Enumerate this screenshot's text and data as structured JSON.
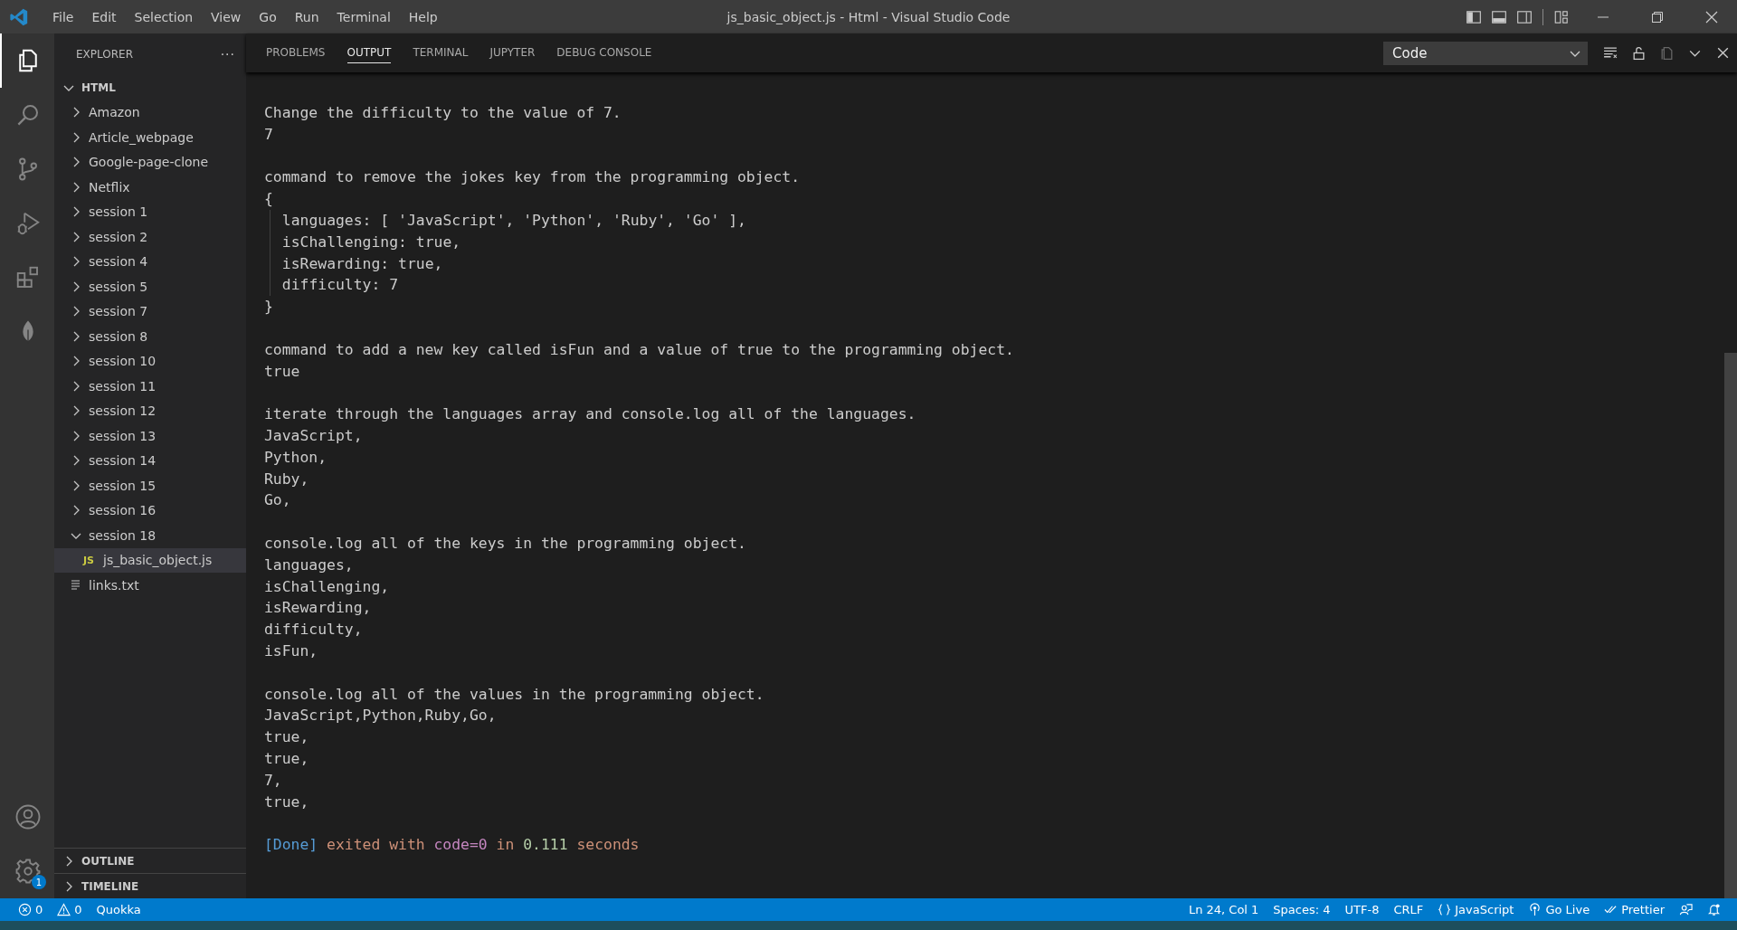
{
  "window": {
    "title": "js_basic_object.js - Html - Visual Studio Code"
  },
  "menu": [
    "File",
    "Edit",
    "Selection",
    "View",
    "Go",
    "Run",
    "Terminal",
    "Help"
  ],
  "activity_bar": {
    "top": [
      {
        "kind": "explorer",
        "selected": true
      },
      {
        "kind": "search",
        "selected": false
      },
      {
        "kind": "source-control",
        "selected": false
      },
      {
        "kind": "run-debug",
        "selected": false
      },
      {
        "kind": "extensions",
        "selected": false
      },
      {
        "kind": "leaf",
        "selected": false
      }
    ],
    "bottom": [
      {
        "kind": "account"
      },
      {
        "kind": "settings",
        "badge": "1"
      }
    ]
  },
  "sidebar": {
    "title": "EXPLORER",
    "more": "···",
    "tree": [
      {
        "label": "HTML",
        "kind": "root",
        "expanded": true,
        "selected": false,
        "children": [
          {
            "label": "Amazon",
            "kind": "folder",
            "expanded": false,
            "selected": false
          },
          {
            "label": "Article_webpage",
            "kind": "folder",
            "expanded": false,
            "selected": false
          },
          {
            "label": "Google-page-clone",
            "kind": "folder",
            "expanded": false,
            "selected": false
          },
          {
            "label": "Netflix",
            "kind": "folder",
            "expanded": false,
            "selected": false
          },
          {
            "label": "session 1",
            "kind": "folder",
            "expanded": false,
            "selected": false
          },
          {
            "label": "session 2",
            "kind": "folder",
            "expanded": false,
            "selected": false
          },
          {
            "label": "session 4",
            "kind": "folder",
            "expanded": false,
            "selected": false
          },
          {
            "label": "session 5",
            "kind": "folder",
            "expanded": false,
            "selected": false
          },
          {
            "label": "session 7",
            "kind": "folder",
            "expanded": false,
            "selected": false
          },
          {
            "label": "session 8",
            "kind": "folder",
            "expanded": false,
            "selected": false
          },
          {
            "label": "session 10",
            "kind": "folder",
            "expanded": false,
            "selected": false
          },
          {
            "label": "session 11",
            "kind": "folder",
            "expanded": false,
            "selected": false
          },
          {
            "label": "session 12",
            "kind": "folder",
            "expanded": false,
            "selected": false
          },
          {
            "label": "session 13",
            "kind": "folder",
            "expanded": false,
            "selected": false
          },
          {
            "label": "session 14",
            "kind": "folder",
            "expanded": false,
            "selected": false
          },
          {
            "label": "session 15",
            "kind": "folder",
            "expanded": false,
            "selected": false
          },
          {
            "label": "session 16",
            "kind": "folder",
            "expanded": false,
            "selected": false
          },
          {
            "label": "session 18",
            "kind": "folder",
            "expanded": true,
            "selected": false,
            "children": [
              {
                "label": "js_basic_object.js",
                "kind": "js-file",
                "badge": "JS",
                "selected": true
              }
            ]
          },
          {
            "label": "links.txt",
            "kind": "text-file",
            "selected": false
          }
        ]
      }
    ],
    "sections": [
      {
        "label": "OUTLINE",
        "expanded": false
      },
      {
        "label": "TIMELINE",
        "expanded": false
      }
    ]
  },
  "panel": {
    "tabs": [
      {
        "label": "PROBLEMS",
        "selected": false
      },
      {
        "label": "OUTPUT",
        "selected": true
      },
      {
        "label": "TERMINAL",
        "selected": false
      },
      {
        "label": "JUPYTER",
        "selected": false
      },
      {
        "label": "DEBUG CONSOLE",
        "selected": false
      }
    ],
    "channel": "Code",
    "output": [
      {
        "lines": [
          {
            "text": "Change the difficulty to the value of 7.",
            "indent": false
          },
          {
            "text": "7",
            "indent": false
          }
        ]
      },
      {
        "lines": [
          {
            "text": "command to remove the jokes key from the programming object.",
            "indent": false
          },
          {
            "text": "{",
            "indent": false
          },
          {
            "text": "languages: [ 'JavaScript', 'Python', 'Ruby', 'Go' ],",
            "indent": true
          },
          {
            "text": "isChallenging: true,",
            "indent": true
          },
          {
            "text": "isRewarding: true,",
            "indent": true
          },
          {
            "text": "difficulty: 7",
            "indent": true
          },
          {
            "text": "}",
            "indent": false
          }
        ]
      },
      {
        "lines": [
          {
            "text": "command to add a new key called isFun and a value of true to the programming object.",
            "indent": false
          },
          {
            "text": "true",
            "indent": false
          }
        ]
      },
      {
        "lines": [
          {
            "text": "iterate through the languages array and console.log all of the languages.",
            "indent": false
          },
          {
            "text": "JavaScript,",
            "indent": false
          },
          {
            "text": "Python,",
            "indent": false
          },
          {
            "text": "Ruby,",
            "indent": false
          },
          {
            "text": "Go,",
            "indent": false
          }
        ]
      },
      {
        "lines": [
          {
            "text": "console.log all of the keys in the programming object.",
            "indent": false
          },
          {
            "text": "languages,",
            "indent": false
          },
          {
            "text": "isChallenging,",
            "indent": false
          },
          {
            "text": "isRewarding,",
            "indent": false
          },
          {
            "text": "difficulty,",
            "indent": false
          },
          {
            "text": "isFun,",
            "indent": false
          }
        ]
      },
      {
        "lines": [
          {
            "text": "console.log all of the values in the programming object.",
            "indent": false
          },
          {
            "text": "JavaScript,Python,Ruby,Go,",
            "indent": false
          },
          {
            "text": "true,",
            "indent": false
          },
          {
            "text": "true,",
            "indent": false
          },
          {
            "text": "7,",
            "indent": false
          },
          {
            "text": "true,",
            "indent": false
          }
        ]
      }
    ],
    "done_line": [
      {
        "text": "[Done]",
        "kind": "tag"
      },
      {
        "text": "exited with",
        "kind": "plain"
      },
      {
        "text": "code=0",
        "kind": "code"
      },
      {
        "text": "in",
        "kind": "plain"
      },
      {
        "text": "0.111",
        "kind": "number"
      },
      {
        "text": "seconds",
        "kind": "plain"
      }
    ]
  },
  "status_bar": {
    "left": [
      {
        "kind": "errors",
        "text": "0"
      },
      {
        "kind": "warnings",
        "text": "0"
      },
      {
        "kind": "plain",
        "text": "Quokka"
      }
    ],
    "right": [
      {
        "kind": "plain",
        "text": "Ln 24, Col 1"
      },
      {
        "kind": "plain",
        "text": "Spaces: 4"
      },
      {
        "kind": "plain",
        "text": "UTF-8"
      },
      {
        "kind": "plain",
        "text": "CRLF"
      },
      {
        "kind": "language",
        "text": "JavaScript"
      },
      {
        "kind": "go-live",
        "text": "Go Live"
      },
      {
        "kind": "prettier",
        "text": "Prettier"
      },
      {
        "kind": "feedback"
      },
      {
        "kind": "notifications"
      }
    ]
  }
}
